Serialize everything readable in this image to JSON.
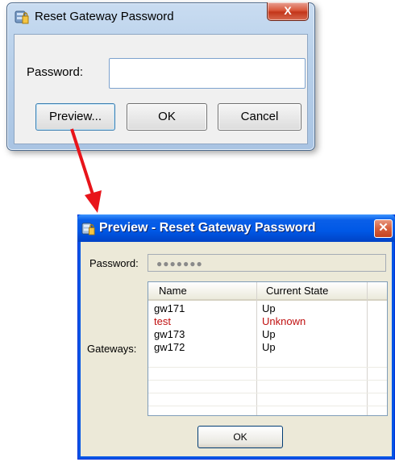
{
  "dialog_main": {
    "title": "Reset Gateway Password",
    "close_label": "X",
    "password_label": "Password:",
    "password_value": "",
    "buttons": {
      "preview": "Preview...",
      "ok": "OK",
      "cancel": "Cancel"
    }
  },
  "dialog_preview": {
    "title": "Preview - Reset Gateway Password",
    "close_label": "✕",
    "password_label": "Password:",
    "password_masked": "●●●●●●●",
    "gateways_label": "Gateways:",
    "columns": {
      "name": "Name",
      "state": "Current State"
    },
    "rows": [
      {
        "name": "gw171",
        "state": "Up"
      },
      {
        "name": "test",
        "state": "Unknown"
      },
      {
        "name": "gw173",
        "state": "Up"
      },
      {
        "name": "gw172",
        "state": "Up"
      }
    ],
    "ok_label": "OK"
  },
  "colors": {
    "arrow": "#e8141a",
    "unknown_state": "#c01010",
    "xp_title": "#0058e6"
  }
}
